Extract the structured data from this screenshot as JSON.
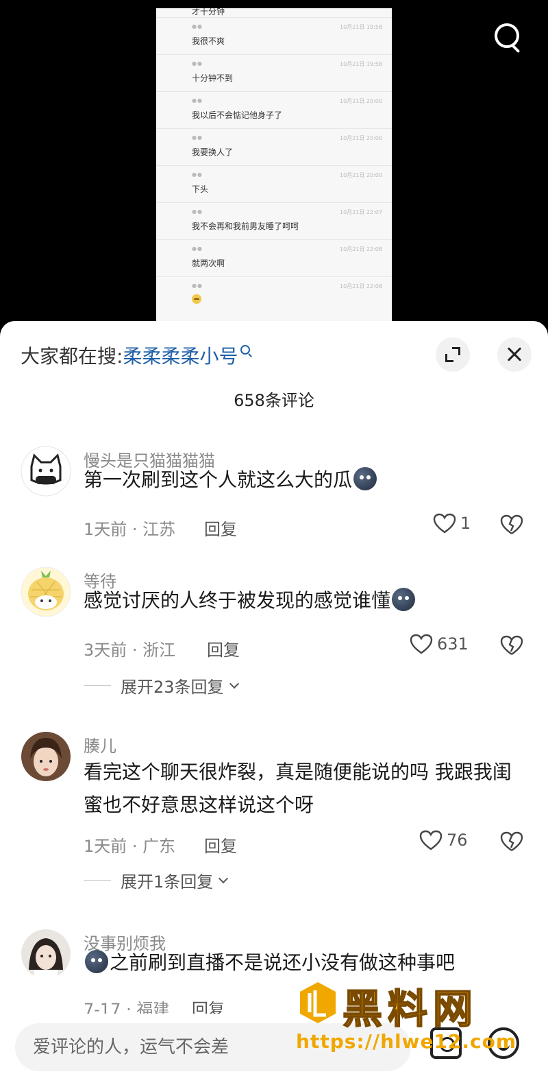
{
  "video": {
    "chat": [
      {
        "name": "",
        "time": "",
        "msg": "才十分钟"
      },
      {
        "name": "●●",
        "time": "10月21日 19:58",
        "msg": "我很不爽"
      },
      {
        "name": "●●",
        "time": "10月21日 19:58",
        "msg": "十分钟不到"
      },
      {
        "name": "●●",
        "time": "10月21日 20:00",
        "msg": "我以后不会惦记他身子了"
      },
      {
        "name": "●●",
        "time": "10月21日 20:00",
        "msg": "我要换人了"
      },
      {
        "name": "●●",
        "time": "10月21日 20:00",
        "msg": "下头"
      },
      {
        "name": "●●",
        "time": "10月21日 22:07",
        "msg": "我不会再和我前男友睡了呵呵"
      },
      {
        "name": "●●",
        "time": "10月21日 22:08",
        "msg": "就两次啊"
      },
      {
        "name": "●●",
        "time": "10月21日 22:08",
        "msg": ""
      }
    ]
  },
  "sheet": {
    "hot_search_prefix": "大家都在搜:",
    "hot_search_keyword": "柔柔柔柔小号",
    "comment_count": "658条评论"
  },
  "comments": [
    {
      "name": "慢头是只猫猫猫猫",
      "text": "第一次刷到这个人就这么大的瓜",
      "meta": "1天前 · 江苏",
      "reply": "回复",
      "likes": "1",
      "expand": ""
    },
    {
      "name": "等待",
      "text": "感觉讨厌的人终于被发现的感觉谁懂",
      "meta": "3天前 · 浙江",
      "reply": "回复",
      "likes": "631",
      "expand": "展开23条回复"
    },
    {
      "name": "腠儿",
      "text": "看完这个聊天很炸裂，真是随便能说的吗 我跟我闺蜜也不好意思这样说这个呀",
      "meta": "1天前 · 广东",
      "reply": "回复",
      "likes": "76",
      "expand": "展开1条回复"
    },
    {
      "name": "没事别烦我",
      "text": "之前刷到直播不是说还小没有做这种事吧",
      "meta": "7-17 · 福建",
      "reply": "回复",
      "likes": "",
      "expand": ""
    }
  ],
  "input": {
    "placeholder": "爱评论的人，运气不会差"
  },
  "watermark": {
    "title": "黑料网",
    "url": "https://hlwe12.com"
  },
  "colors": {
    "keyword": "#1f5fa8",
    "watermark": "#f0a800"
  }
}
